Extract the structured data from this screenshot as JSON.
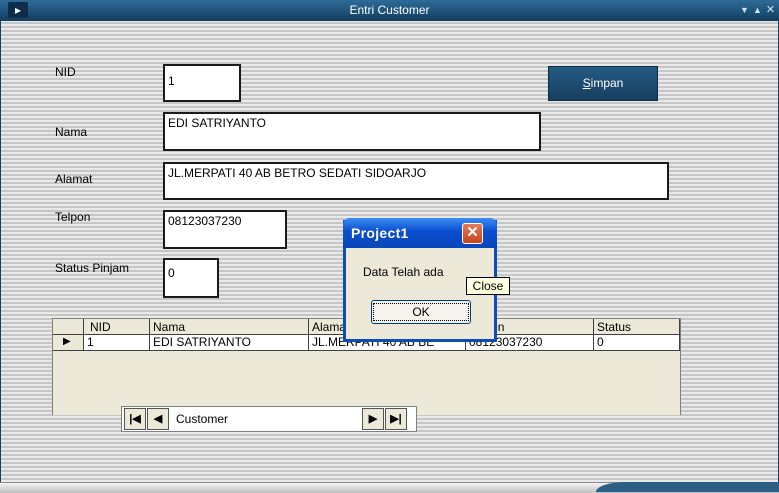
{
  "window": {
    "title": "Entri Customer"
  },
  "form": {
    "nid_label": "NID",
    "nid_value": "1",
    "nama_label": "Nama",
    "nama_value": "EDI SATRIYANTO",
    "alamat_label": "Alamat",
    "alamat_value": "JL.MERPATI 40 AB BETRO SEDATI SIDOARJO",
    "telpon_label": "Telpon",
    "telpon_value": "08123037230",
    "status_label": "Status Pinjam",
    "status_value": "0",
    "simpan_hotkey": "S",
    "simpan_rest": "impan"
  },
  "grid": {
    "columns": [
      "NID",
      "Nama",
      "Alamat",
      "Telpon",
      "Status"
    ],
    "rows": [
      {
        "nid": "1",
        "nama": "EDI SATRIYANTO",
        "alamat": "JL.MERPATI 40 AB BE",
        "telpon": "08123037230",
        "status": "0"
      }
    ]
  },
  "datacontrol": {
    "caption": "Customer"
  },
  "messagebox": {
    "title": "Project1",
    "message": "Data Telah ada",
    "ok_label": "OK",
    "tooltip": "Close"
  },
  "colors": {
    "titlebar": "#123c5f",
    "button": "#1b4a6e",
    "msg_title": "#0a4dcf"
  }
}
